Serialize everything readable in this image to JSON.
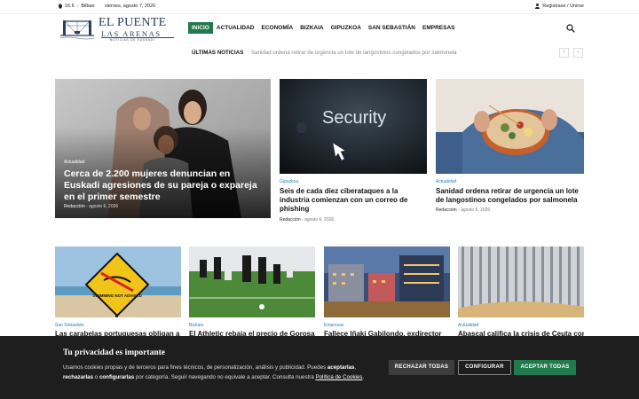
{
  "topbar": {
    "temp": "16.6",
    "deg": "°",
    "city": "Bilbao",
    "date": "viernes, agosto 7, 2026",
    "login": "Registrase / Unirse"
  },
  "logo": {
    "line1": "EL PUENTE",
    "line2": "LAS ARENAS",
    "line3": "NOTICIAS DE EUSKADI"
  },
  "nav": {
    "items": [
      "Inicio",
      "Actualidad",
      "Economía",
      "Bizkaia",
      "Gipuzkoa",
      "San Sebastián",
      "Empresas"
    ]
  },
  "ticker": {
    "label": "ÚLTIMAS NOTICIAS",
    "text": "Sanidad ordena retirar de urgencia un lote de langostinos congelados por salmonela",
    "prev": "‹",
    "next": "›"
  },
  "hero": {
    "category": "Actualidad",
    "title": "Cerca de 2.200 mujeres denuncian en Euskadi agresiones de su pareja o expareja en el primer semestre",
    "author": "Redacción",
    "sep": "-",
    "date": "agosto 6, 2026"
  },
  "card_security": {
    "category": "Gipuzkoa",
    "title": "Seis de cada diez ciberataques a la industria comienzan con un correo de phishing",
    "author": "Redacción",
    "sep": "-",
    "date": "agosto 6, 2026",
    "img_word": "Security"
  },
  "card_food": {
    "category": "Actualidad",
    "title": "Sanidad ordena retirar de urgencia un lote de langostinos congelados por salmonela",
    "author": "Redacción",
    "sep": "-",
    "date": "agosto 5, 2026"
  },
  "row2": [
    {
      "category": "San Sebastián",
      "title": "Las carabelas portuguesas obligan a",
      "sign_text": "SWIMMING NOT ADVISED"
    },
    {
      "category": "Bizkaia",
      "title": "El Athletic rebaja el precio de Gorosabel"
    },
    {
      "category": "Empresas",
      "title": "Fallece Iñaki Gabilondo, exdirector"
    },
    {
      "category": "Actualidad",
      "title": "Abascal califica la crisis de Ceuta como"
    }
  ],
  "cookie": {
    "title": "Tu privacidad es importante",
    "text_a": "Usamos cookies propias y de terceros para fines técnicos, de personalización, análisis y publicidad. Puedes ",
    "b1": "aceptarlas",
    "text_b": ", ",
    "b2": "rechazarlas",
    "text_c": " o ",
    "b3": "configurarlas",
    "text_d": " por categoría. Seguir navegando no equivale a aceptar. Consulta nuestra ",
    "link": "Política de Cookies",
    "text_e": ".",
    "reject": "RECHAZAR TODAS",
    "configure": "CONFIGURAR",
    "accept": "ACEPTAR TODAS"
  },
  "colors": {
    "accent": "#1f7a4c",
    "category": "#2a7fb8",
    "cookie_bg": "#1e1e1e",
    "logo": "#2b4060"
  }
}
